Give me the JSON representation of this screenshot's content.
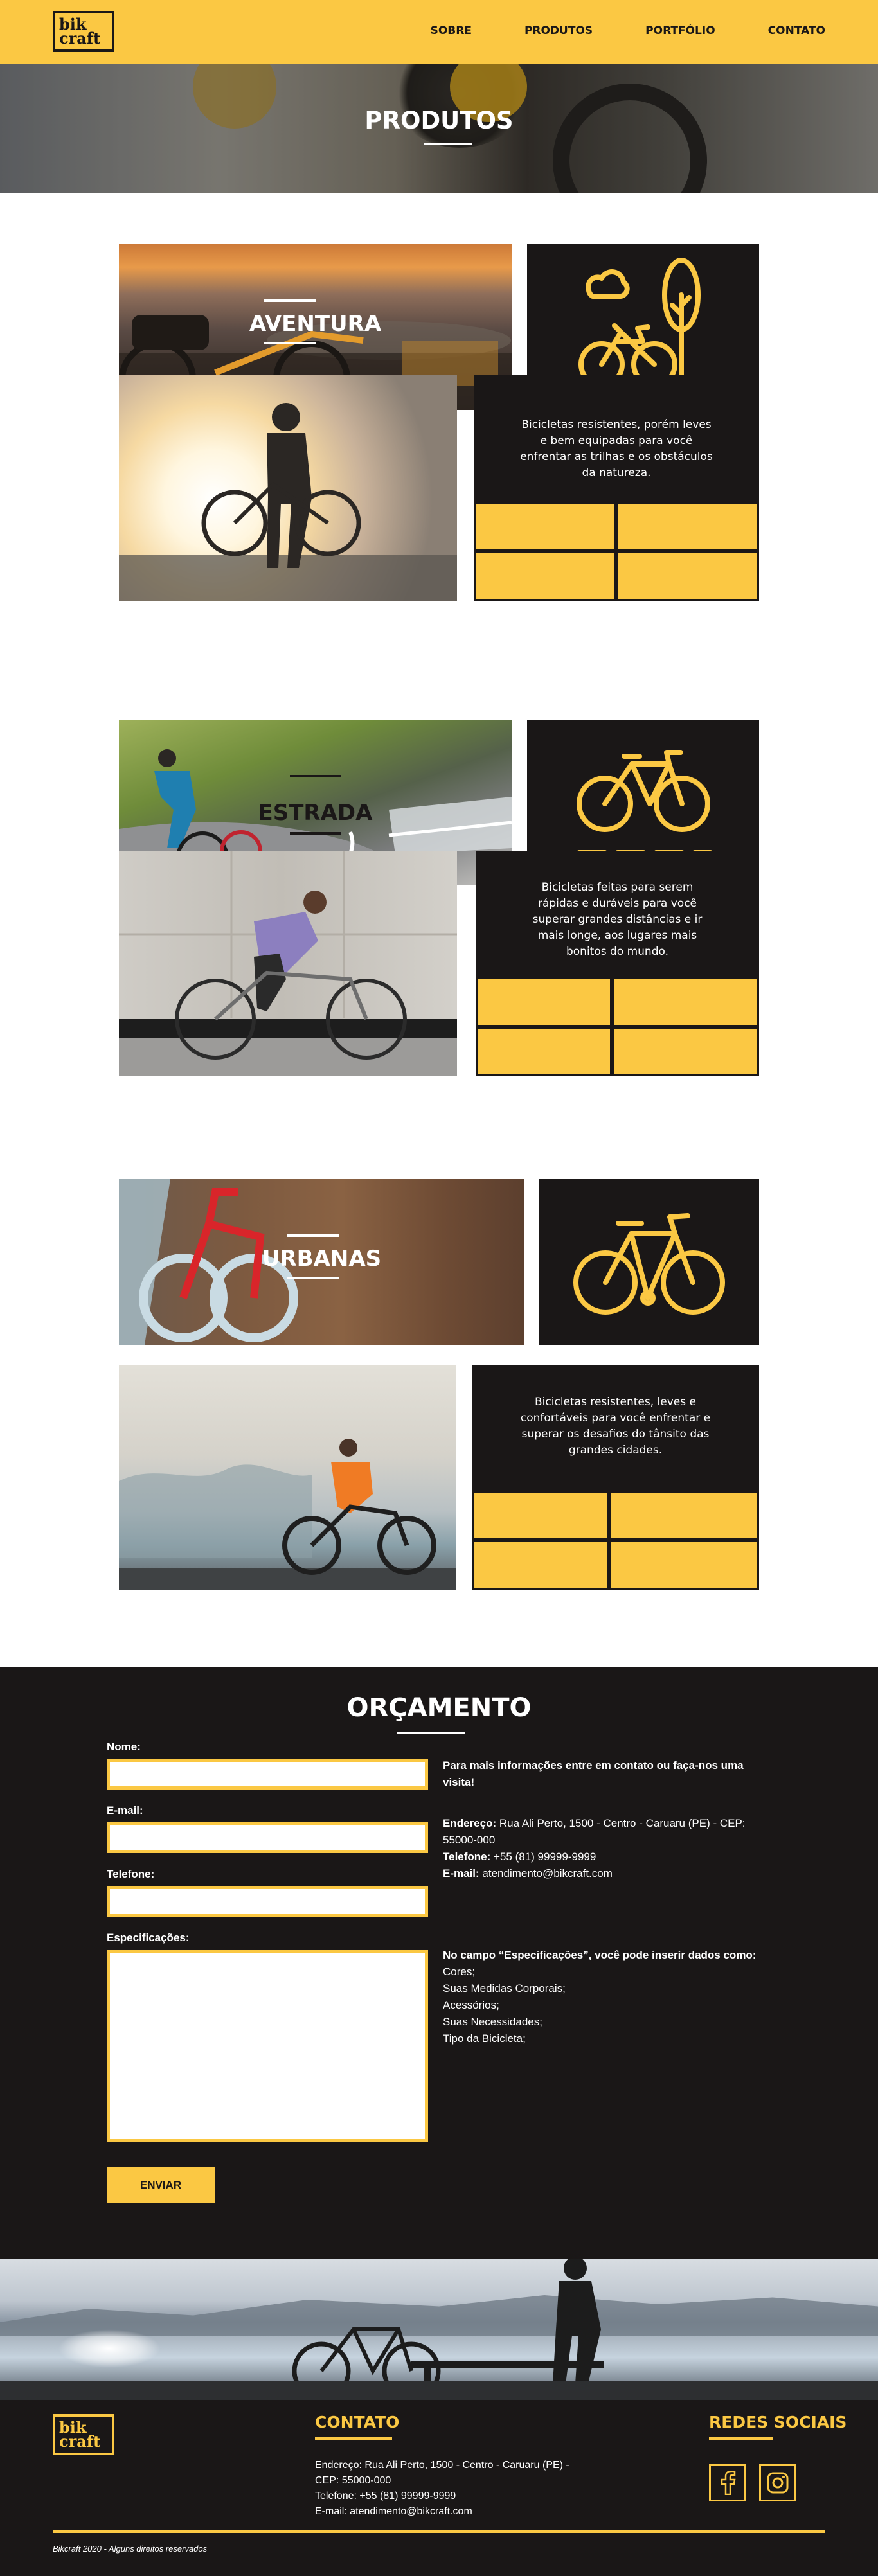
{
  "header": {
    "logo": [
      "bik",
      "craft"
    ],
    "nav": [
      "Sobre",
      "Produtos",
      "Portfólio",
      "Contato"
    ]
  },
  "hero": {
    "title": "PRODUTOS"
  },
  "products": [
    {
      "title": "AVENTURA",
      "description": "Bicicletas resistentes, porém leves e bem equipadas para você enfrentar as trilhas e os obstáculos da natureza.",
      "icon": "bike-tree-cloud-icon"
    },
    {
      "title": "ESTRADA",
      "description": "Bicicletas feitas para serem rápidas e duráveis para você superar grandes distâncias e ir mais longe, aos lugares mais bonitos do mundo.",
      "icon": "road-bike-icon"
    },
    {
      "title": "URBANAS",
      "description": "Bicicletas resistentes, leves e confortáveis para você enfrentar e superar os desafios do tânsito das grandes cidades.",
      "icon": "city-bike-icon"
    }
  ],
  "orcamento": {
    "title": "ORÇAMENTO",
    "labels": {
      "nome": "Nome:",
      "email": "E-mail:",
      "telefone": "Telefone:",
      "especificacoes": "Especificações:"
    },
    "values": {
      "nome": "",
      "email": "",
      "telefone": "",
      "especificacoes": ""
    },
    "submit": "ENVIAR",
    "info_title": "Para mais informações entre em contato ou faça-nos uma visita!",
    "endereco_label": "Endereço:",
    "endereco": "Rua Ali Perto, 1500 - Centro - Caruaru (PE) - CEP: 55000-000",
    "telefone_label": "Telefone:",
    "telefone": "+55 (81) 99999-9999",
    "email_label": "E-mail:",
    "email": "atendimento@bikcraft.com",
    "spec_title": "No campo “Especificações”, você pode inserir dados como:",
    "spec_items": [
      "Cores;",
      "Suas Medidas Corporais;",
      "Acessórios;",
      "Suas Necessidades;",
      "Tipo da Bicicleta;"
    ]
  },
  "footer": {
    "logo": [
      "bik",
      "craft"
    ],
    "contato_title": "CONTATO",
    "endereco": "Endereço: Rua Ali Perto, 1500 - Centro - Caruaru (PE) - CEP: 55000-000",
    "telefone": "Telefone: +55 (81) 99999-9999",
    "email": "E-mail: atendimento@bikcraft.com",
    "social_title": "REDES SOCIAIS",
    "social": [
      "facebook-icon",
      "instagram-icon"
    ],
    "copyright": "Bikcraft 2020 - Alguns direitos reservados"
  },
  "colors": {
    "accent": "#fbc843",
    "dark": "#1a1717",
    "light": "#ffffff"
  }
}
